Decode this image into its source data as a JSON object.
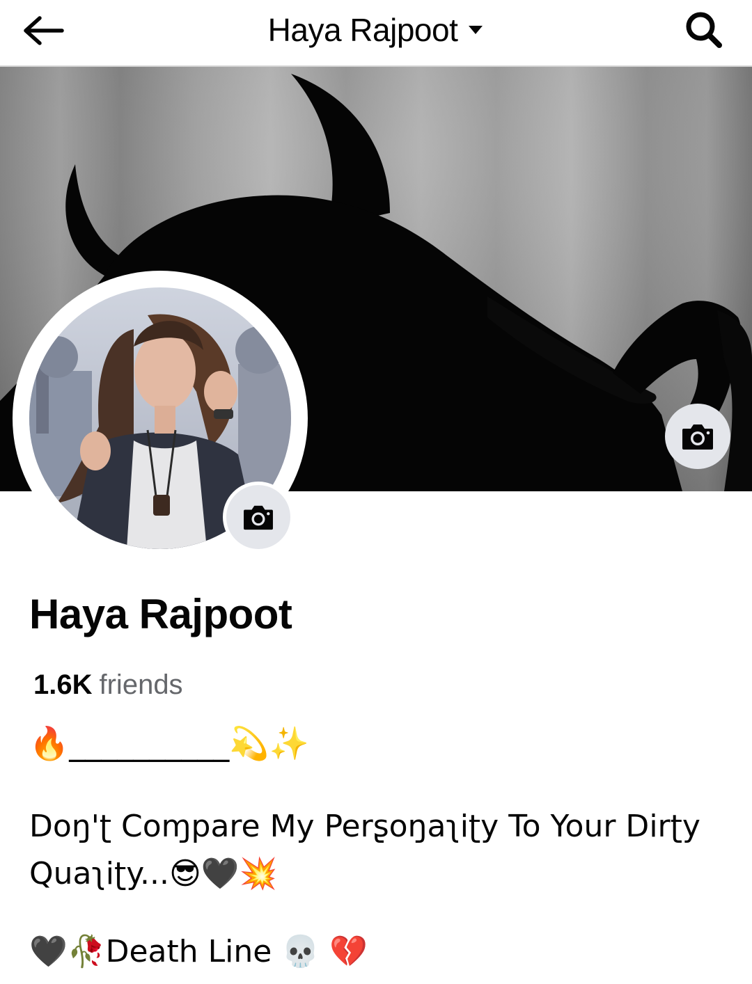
{
  "header": {
    "title": "Haya Rajpoot",
    "back_icon": "arrow-left-icon",
    "dropdown_icon": "caret-down-icon",
    "search_icon": "search-icon"
  },
  "cover": {
    "camera_icon": "camera-icon"
  },
  "avatar": {
    "camera_icon": "camera-icon"
  },
  "profile": {
    "name": "Haya Rajpoot",
    "friends_count": "1.6K",
    "friends_label": "friends"
  },
  "bio": {
    "line1": "🔥__________💫✨",
    "line2": "Doŋ'ʈ Coɱpare My Perʂoŋaʅiʈy To Your Dirʈy Quaʅiʈy...😎🖤💥",
    "line3": "🖤🥀Death Line 💀 💔"
  },
  "colors": {
    "text_primary": "#050505",
    "text_secondary": "#65676b",
    "button_bg": "#e4e6eb",
    "divider": "#d6d6d6"
  }
}
